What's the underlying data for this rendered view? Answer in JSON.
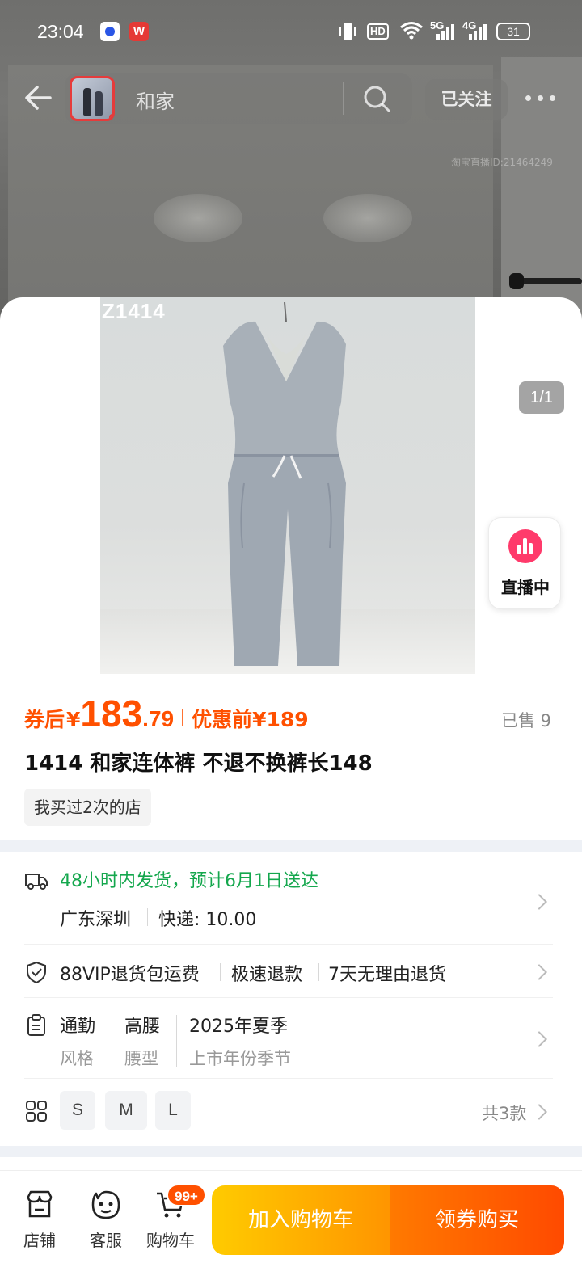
{
  "status_bar": {
    "time": "23:04",
    "network_hd": "HD",
    "network_5g": "5G",
    "network_4g": "4G",
    "battery": "31",
    "app_icons": [
      "baidu-icon",
      "w-app-icon"
    ]
  },
  "nav": {
    "search_text": "和家",
    "follow_label": "已关注",
    "watermark": "淘宝直播ID:21464249"
  },
  "gallery": {
    "image_code": "Z1414",
    "counter": "1/1",
    "live_label": "直播中"
  },
  "price": {
    "label": "券后",
    "currency": "¥",
    "integer": "183",
    "decimal": ".79",
    "original": "优惠前¥189",
    "sold": "已售 9"
  },
  "product": {
    "title": "1414 和家连体裤 不退不换裤长148",
    "bought_tag": "我买过2次的店"
  },
  "shipping": {
    "main": "48小时内发货，预计6月1日送达",
    "from": "广东深圳",
    "fee": "快递: 10.00"
  },
  "guarantees": [
    "88VIP退货包运费",
    "极速退款",
    "7天无理由退货"
  ],
  "specs": [
    {
      "value": "通勤",
      "key": "风格"
    },
    {
      "value": "高腰",
      "key": "腰型"
    },
    {
      "value": "2025年夏季",
      "key": "上市年份季节"
    }
  ],
  "sku": {
    "sizes": [
      "S",
      "M",
      "L"
    ],
    "total": "共3款"
  },
  "bottom_bar": {
    "shop_label": "店铺",
    "service_label": "客服",
    "cart_label": "购物车",
    "cart_badge": "99+",
    "add_cart_label": "加入购物车",
    "buy_label": "领券购买"
  },
  "colors": {
    "accent": "#ff5000",
    "green": "#14a74d",
    "live": "#ff3a6b"
  }
}
